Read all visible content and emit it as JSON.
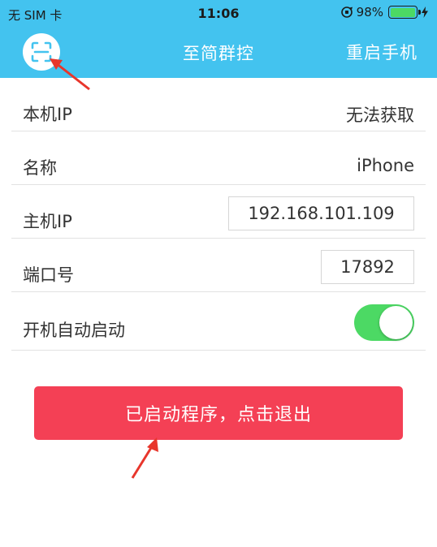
{
  "status_bar": {
    "carrier": "无 SIM 卡",
    "time": "11:06",
    "battery_percent": "98%",
    "battery_level": 0.98,
    "icons": [
      "orientation-lock-icon",
      "battery-icon",
      "charging-icon"
    ]
  },
  "nav": {
    "title": "至简群控",
    "right_button": "重启手机",
    "left_icon": "scan-icon"
  },
  "rows": {
    "local_ip": {
      "label": "本机IP",
      "value": "无法获取"
    },
    "name": {
      "label": "名称",
      "value": "iPhone"
    },
    "host_ip": {
      "label": "主机IP",
      "value": "192.168.101.109"
    },
    "port": {
      "label": "端口号",
      "value": "17892"
    },
    "auto_start": {
      "label": "开机自动启动",
      "enabled": true
    }
  },
  "exit_button": {
    "label": "已启动程序，点击退出"
  },
  "colors": {
    "header": "#43c3ef",
    "toggle_on": "#4cd964",
    "exit_button": "#f44055",
    "annotation_arrow": "#e8362c"
  }
}
